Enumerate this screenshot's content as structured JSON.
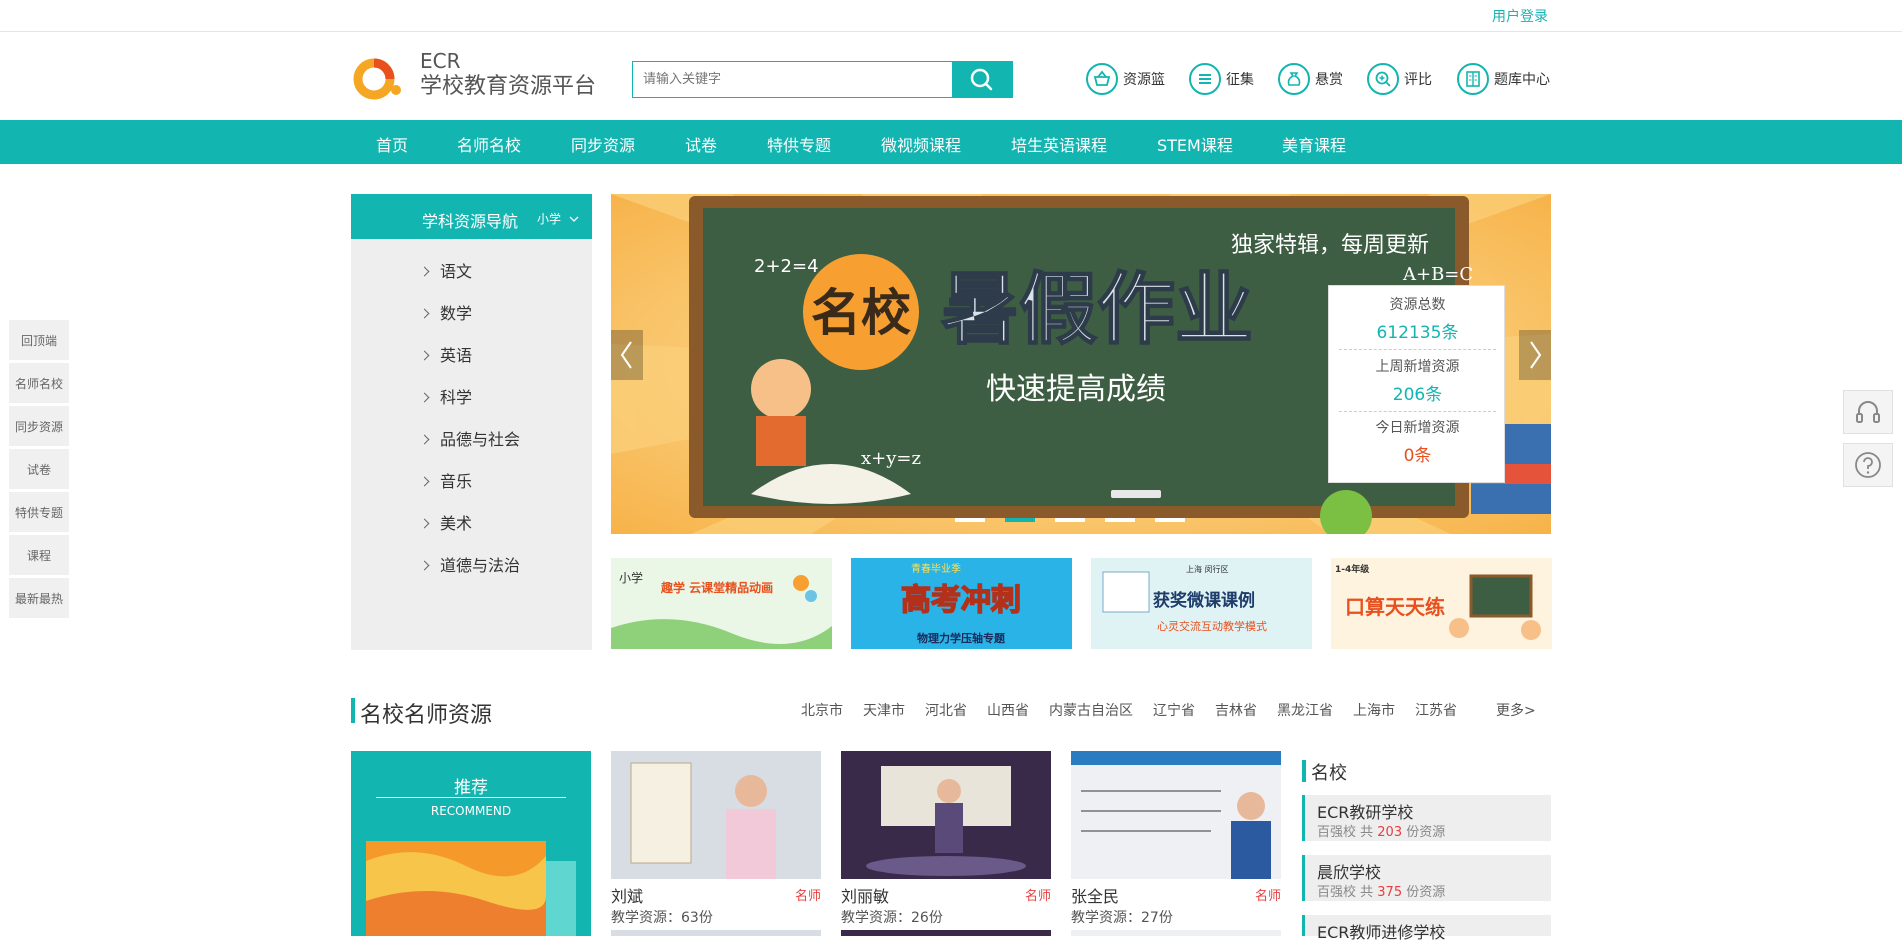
{
  "topbar": {
    "login": "用户登录"
  },
  "logo": {
    "line1": "ECR",
    "line2": "学校教育资源平台"
  },
  "search": {
    "placeholder": "请输入关键字"
  },
  "header_icons": [
    {
      "label": "资源篮",
      "icon": "basket-icon"
    },
    {
      "label": "征集",
      "icon": "list-icon"
    },
    {
      "label": "悬赏",
      "icon": "money-bag-icon"
    },
    {
      "label": "评比",
      "icon": "zoom-icon"
    },
    {
      "label": "题库中心",
      "icon": "book-icon"
    }
  ],
  "nav": [
    "首页",
    "名师名校",
    "同步资源",
    "试卷",
    "特供专题",
    "微视频课程",
    "培生英语课程",
    "STEM课程",
    "美育课程"
  ],
  "quickbar": [
    "回顶端",
    "名师名校",
    "同步资源",
    "试卷",
    "特供专题",
    "课程",
    "最新最热"
  ],
  "subject_nav": {
    "title": "学科资源导航",
    "level": "小学",
    "items": [
      "语文",
      "数学",
      "英语",
      "科学",
      "品德与社会",
      "音乐",
      "美术",
      "道德与法治"
    ]
  },
  "banner": {
    "text_main": "暑假作业",
    "text_badge": "名校",
    "text_sub": "快速提高成绩",
    "text_corner": "独家特辑，每周更新",
    "formula1": "2+2=4",
    "formula2": "A+B=C",
    "formula3": "x+y=z",
    "active_slide": 2,
    "slides_count": 5
  },
  "stats": [
    {
      "label": "资源总数",
      "value": "612135条",
      "color": "#13b5b1"
    },
    {
      "label": "上周新增资源",
      "value": "206条",
      "color": "#13b5b1"
    },
    {
      "label": "今日新增资源",
      "value": "0条",
      "color": "#e8501e"
    }
  ],
  "sub_banners": [
    {
      "tag": "小学",
      "title": "趣学 云课堂精品动画"
    },
    {
      "tag": "青春毕业季",
      "title": "高考冲刺",
      "sub": "物理力学压轴专题"
    },
    {
      "tag": "上海 闵行区",
      "title": "获奖微课课例",
      "sub": "心灵交流互动教学模式"
    },
    {
      "tag": "1-4年级",
      "title": "口算天天练"
    }
  ],
  "section": {
    "title": "名校名师资源",
    "provinces": [
      "北京市",
      "天津市",
      "河北省",
      "山西省",
      "内蒙古自治区",
      "辽宁省",
      "吉林省",
      "黑龙江省",
      "上海市",
      "江苏省"
    ],
    "more": "更多>"
  },
  "recommend": {
    "title": "推荐",
    "subtitle": "RECOMMEND"
  },
  "teachers": [
    {
      "name": "刘斌",
      "tag": "名师",
      "count": "教学资源：63份"
    },
    {
      "name": "刘丽敏",
      "tag": "名师",
      "count": "教学资源：26份"
    },
    {
      "name": "张全民",
      "tag": "名师",
      "count": "教学资源：27份"
    }
  ],
  "schools": {
    "title": "名校",
    "items": [
      {
        "name": "ECR教研学校",
        "pre": "百强校 共",
        "num": "203",
        "post": "份资源"
      },
      {
        "name": "晨欣学校",
        "pre": "百强校 共",
        "num": "375",
        "post": "份资源"
      },
      {
        "name": "ECR教师进修学校",
        "pre": "",
        "num": "",
        "post": ""
      }
    ]
  }
}
